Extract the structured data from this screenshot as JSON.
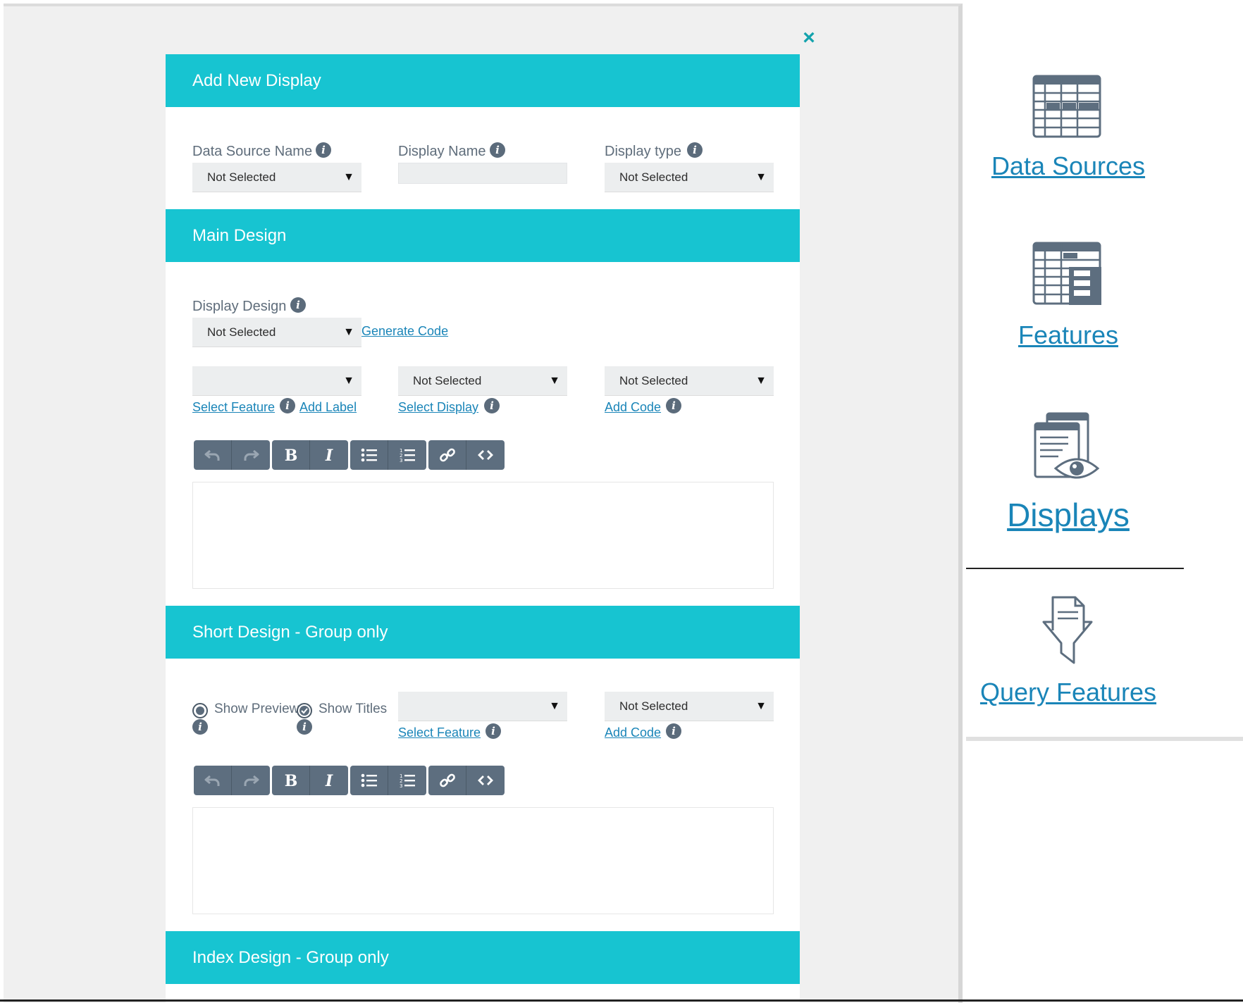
{
  "dialog": {
    "close_icon": "close-icon",
    "sections": {
      "add_new_display": "Add New Display",
      "main_design": "Main Design",
      "short_design": "Short Design - Group only",
      "index_design": "Index Design - Group only"
    },
    "fields": {
      "data_source_name": {
        "label": "Data Source Name",
        "value": "Not Selected"
      },
      "display_name": {
        "label": "Display Name",
        "value": ""
      },
      "display_type": {
        "label": "Display type",
        "value": "Not Selected"
      },
      "display_design": {
        "label": "Display Design",
        "value": "Not Selected"
      }
    },
    "main": {
      "generate_code": "Generate Code",
      "feature_select_value": "",
      "display_select_value": "Not Selected",
      "code_select_value": "Not Selected",
      "select_feature": "Select Feature ",
      "add_label": "Add Label",
      "select_display": "Select Display ",
      "add_code": "Add Code "
    },
    "short": {
      "show_preview": "Show Preview",
      "show_titles": "Show Titles",
      "feature_select_value": "",
      "code_select_value": "Not Selected",
      "select_feature": "Select Feature ",
      "add_code": "Add Code "
    },
    "toolbar_icons": [
      "undo-icon",
      "redo-icon",
      "bold-icon",
      "italic-icon",
      "bullet-list-icon",
      "numbered-list-icon",
      "link-icon",
      "code-icon"
    ]
  },
  "sidebar": {
    "items": [
      {
        "label": "Data Sources",
        "icon": "table-icon"
      },
      {
        "label": "Features",
        "icon": "features-table-icon"
      },
      {
        "label": "Displays",
        "icon": "display-eye-icon",
        "active": true
      },
      {
        "label": "Query Features",
        "icon": "funnel-document-icon"
      }
    ]
  },
  "colors": {
    "header_band": "#17c4d1",
    "link": "#1a85b8",
    "toolbar": "#5d6e7f",
    "workspace": "#f0f0f0"
  }
}
